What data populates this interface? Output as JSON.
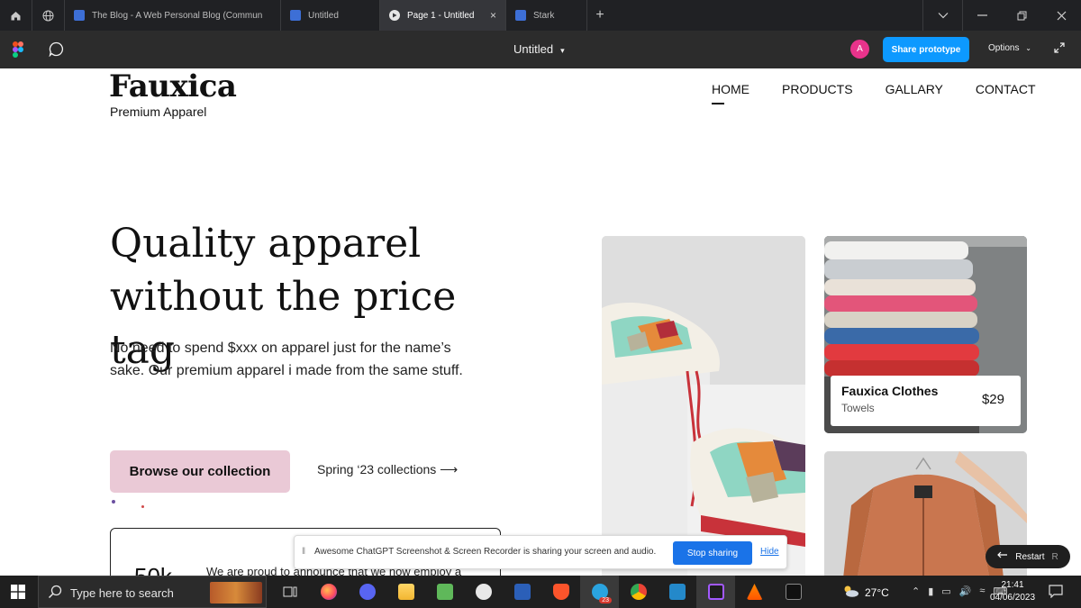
{
  "browser": {
    "tabs": [
      {
        "label": "The Blog - A Web Personal Blog (Commun",
        "active": false
      },
      {
        "label": "Untitled",
        "active": false
      },
      {
        "label": "Page 1 - Untitled",
        "active": true
      },
      {
        "label": "Stark",
        "active": false
      }
    ],
    "close_glyph": "×",
    "newtab_glyph": "+"
  },
  "figma": {
    "file_title": "Untitled",
    "avatar_initial": "A",
    "share_label": "Share prototype",
    "options_label": "Options"
  },
  "site": {
    "brand": "Fauxica",
    "brand_sub": "Premium Apparel",
    "nav": [
      "HOME",
      "PRODUCTS",
      "GALLARY",
      "CONTACT"
    ],
    "hero_title_1": "Quality apparel",
    "hero_title_2": "without the price tag",
    "hero_desc": "No need to spend $xxx on apparel just for the name’s sake. Our premium apparel i made from the same stuff.",
    "cta_label": "Browse our collection",
    "secondary_link": "Spring ‘23 collections ⟶",
    "stat_number": "50k",
    "stat_text": "We are proud to announce that we now employ a",
    "product_card": {
      "title": "Fauxica Clothes",
      "subtitle": "Towels",
      "price": "$29"
    }
  },
  "share_banner": {
    "text": "Awesome ChatGPT Screenshot & Screen Recorder is sharing your screen and audio.",
    "stop_label": "Stop sharing",
    "hide_label": "Hide"
  },
  "restart": {
    "label": "Restart",
    "key": "R"
  },
  "taskbar": {
    "search_placeholder": "Type here to search",
    "telegram_badge": "23",
    "temperature": "27°C",
    "time": "21:41",
    "date": "04/06/2023"
  },
  "colors": {
    "cta_bg": "#eac9d6",
    "share_button": "#0d99ff",
    "stop_button": "#1a73e8",
    "avatar": "#e8338b"
  }
}
